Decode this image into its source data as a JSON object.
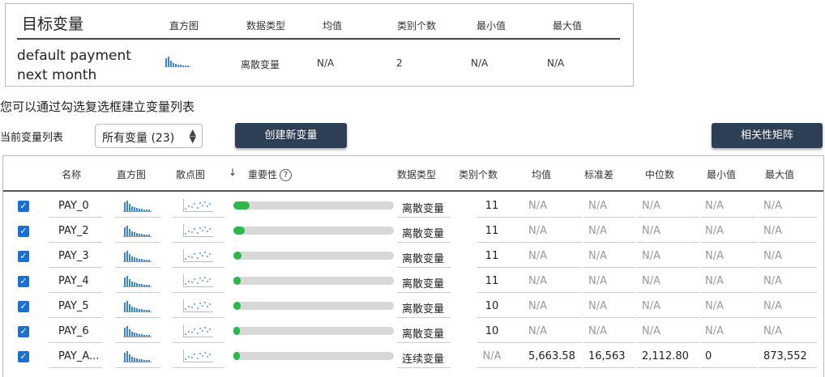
{
  "target": {
    "headers": [
      "目标变量",
      "直方图",
      "数据类型",
      "均值",
      "类别个数",
      "最小值",
      "最大值"
    ],
    "name_line1": "default payment",
    "name_line2": "next month",
    "type": "离散变量",
    "mean": "N/A",
    "categories": "2",
    "min": "N/A",
    "max": "N/A"
  },
  "hint_text": "您可以通过勾选复选框建立变量列表",
  "current_list_label": "当前变量列表",
  "list_select": {
    "value": "所有变量 (23)",
    "caret_up": "▲",
    "caret_down": "▼"
  },
  "create_button": "创建新变量",
  "corr_button": "相关性矩阵",
  "var_table": {
    "headers": {
      "name": "名称",
      "hist": "直方图",
      "scatter": "散点图",
      "sort_arrow": "↓",
      "importance": "重要性",
      "info": "?",
      "dtype": "数据类型",
      "cat_count": "类别个数",
      "mean": "均值",
      "std": "标准差",
      "median": "中位数",
      "min": "最小值",
      "max": "最大值"
    },
    "check_mark": "✓",
    "rows": [
      {
        "name": "PAY_0",
        "importance": 0.1,
        "dtype": "离散变量",
        "cat_count": "11",
        "mean": "N/A",
        "std": "N/A",
        "median": "N/A",
        "min": "N/A",
        "max": "N/A"
      },
      {
        "name": "PAY_2",
        "importance": 0.07,
        "dtype": "离散变量",
        "cat_count": "11",
        "mean": "N/A",
        "std": "N/A",
        "median": "N/A",
        "min": "N/A",
        "max": "N/A"
      },
      {
        "name": "PAY_3",
        "importance": 0.05,
        "dtype": "离散变量",
        "cat_count": "11",
        "mean": "N/A",
        "std": "N/A",
        "median": "N/A",
        "min": "N/A",
        "max": "N/A"
      },
      {
        "name": "PAY_4",
        "importance": 0.045,
        "dtype": "离散变量",
        "cat_count": "11",
        "mean": "N/A",
        "std": "N/A",
        "median": "N/A",
        "min": "N/A",
        "max": "N/A"
      },
      {
        "name": "PAY_5",
        "importance": 0.045,
        "dtype": "离散变量",
        "cat_count": "10",
        "mean": "N/A",
        "std": "N/A",
        "median": "N/A",
        "min": "N/A",
        "max": "N/A"
      },
      {
        "name": "PAY_6",
        "importance": 0.04,
        "dtype": "离散变量",
        "cat_count": "10",
        "mean": "N/A",
        "std": "N/A",
        "median": "N/A",
        "min": "N/A",
        "max": "N/A"
      },
      {
        "name": "PAY_A...",
        "importance": 0.03,
        "dtype": "连续变量",
        "cat_count": "N/A",
        "mean": "5,663.58",
        "std": "16,563",
        "median": "2,112.80",
        "min": "0",
        "max": "873,552"
      }
    ]
  },
  "colors": {
    "button_bg": "#2e3e55",
    "checkbox": "#1a6fd1",
    "importance_fill": "#2db84b",
    "histogram_bar": "#3a86d8",
    "scatter_dot": "#5a9be0"
  }
}
